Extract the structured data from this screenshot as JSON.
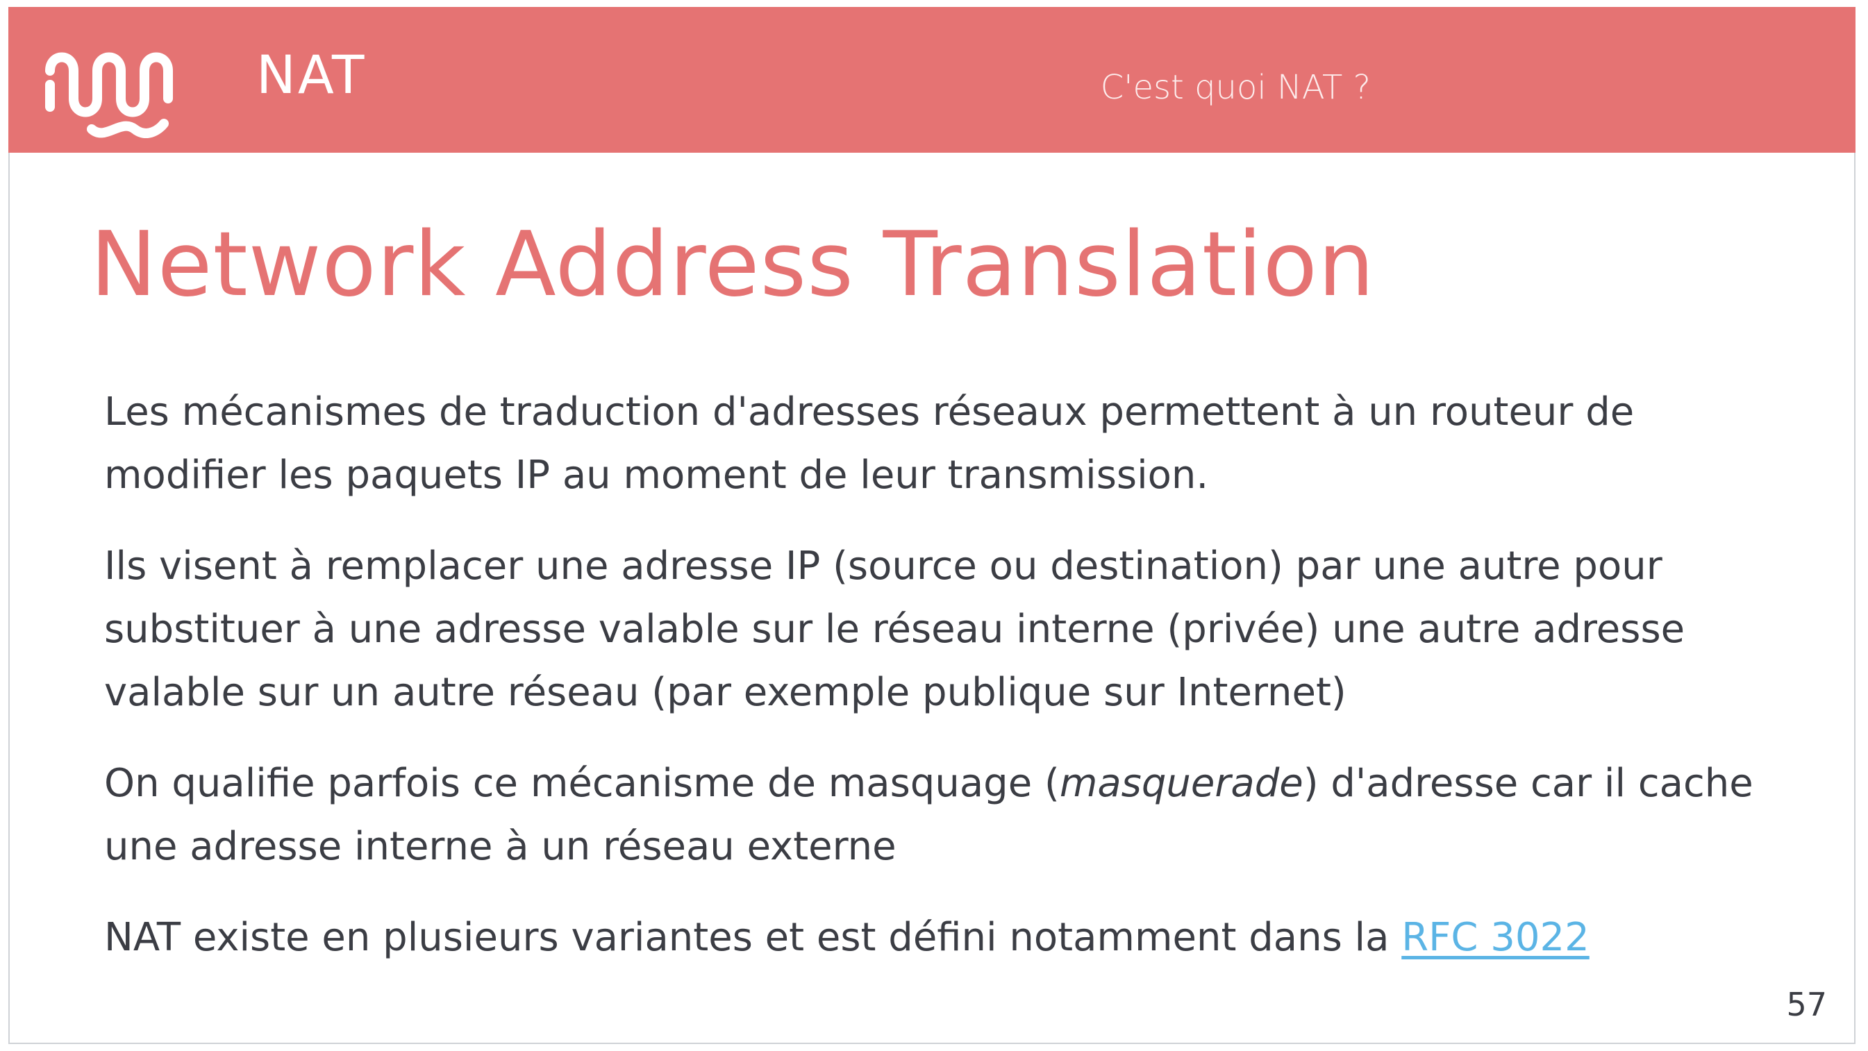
{
  "header": {
    "logo_icon": "wave-logo-icon",
    "title": "NAT",
    "subtitle": "C'est quoi NAT ?",
    "background_color": "#e57373"
  },
  "slide": {
    "title": "Network Address Translation",
    "title_color": "#e57373",
    "paragraphs": {
      "p1": "Les mécanismes de traduction d'adresses réseaux permettent à un routeur de modifier les paquets IP au moment de leur transmission.",
      "p2": "Ils visent à remplacer une adresse IP (source ou destination) par une autre pour substituer à une adresse valable sur le réseau interne (privée) une autre adresse valable sur un autre réseau (par exemple publique sur Internet)",
      "p3": {
        "before": "On qualifie parfois ce mécanisme de masquage (",
        "emphasis": "masquerade",
        "after": ") d'adresse car il cache une adresse interne à un réseau externe"
      },
      "p4": {
        "text": "NAT existe en plusieurs variantes et est défini notamment dans la ",
        "link_text": "RFC 3022",
        "link_color": "#5bb4e5"
      }
    },
    "page_number": "57"
  }
}
